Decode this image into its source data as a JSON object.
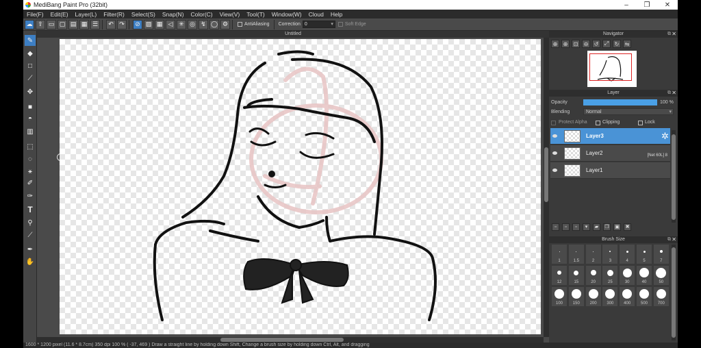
{
  "app": {
    "title": "MediBang Paint Pro (32bit)",
    "window_controls": {
      "minimize": "–",
      "maximize": "❐",
      "close": "✕"
    }
  },
  "menu": [
    "File(F)",
    "Edit(E)",
    "Layer(L)",
    "Filter(R)",
    "Select(S)",
    "Snap(N)",
    "Color(C)",
    "View(V)",
    "Tool(T)",
    "Window(W)",
    "Cloud",
    "Help"
  ],
  "toolbar": {
    "antialiasing_label": "AntiAliasing",
    "correction_label": "Correction",
    "correction_value": "0",
    "soft_edge_label": "Soft Edge"
  },
  "document": {
    "tab_title": "Untitled"
  },
  "status": {
    "text": "1600 * 1200 pixel   (11.6 * 8.7cm)   350 dpi   100 %   ( -37, 469 )   Draw a straight line by holding down Shift, Change a brush size by holding down Ctrl, Alt, and dragging"
  },
  "navigator": {
    "title": "Navigator"
  },
  "layer_panel": {
    "title": "Layer",
    "opacity_label": "Opacity",
    "opacity_value": "100 %",
    "opacity": 1.0,
    "blending_label": "Blending",
    "blending_value": "Normal",
    "protect_alpha_label": "Protect Alpha",
    "clipping_label": "Clipping",
    "lock_label": "Lock",
    "layers": [
      {
        "name": "Layer3",
        "selected": true,
        "extra": ""
      },
      {
        "name": "Layer2",
        "selected": false,
        "extra": "[Net 60L] 8"
      },
      {
        "name": "Layer1",
        "selected": false,
        "extra": ""
      }
    ]
  },
  "brush_size_panel": {
    "title": "Brush Size",
    "sizes": [
      "1",
      "1.5",
      "2",
      "3",
      "4",
      "5",
      "7",
      "12",
      "15",
      "20",
      "25",
      "30",
      "40",
      "50",
      "100",
      "150",
      "200",
      "300",
      "400",
      "500",
      "700"
    ]
  },
  "colors": {
    "accent": "#4a93d6",
    "panel": "#3a3a3a",
    "toolbar": "#4a4a4a"
  }
}
